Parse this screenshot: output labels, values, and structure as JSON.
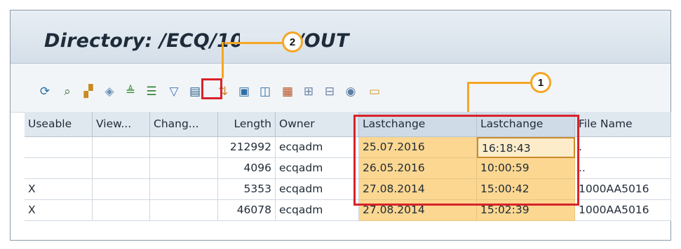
{
  "window": {
    "title": "Directory: /ECQ/10  /WM/OUT"
  },
  "toolbar": {
    "icons": [
      "refresh-icon",
      "search-detail-icon",
      "copy-icon",
      "eraser-icon",
      "sort-ascending-icon",
      "filter-rows-icon",
      "set-filter-icon",
      "export-excel-icon",
      "sort-icon",
      "display-icon",
      "layout-icon",
      "grid-icon",
      "column-icon",
      "column-split-icon",
      "database-icon",
      "folder-icon"
    ]
  },
  "callouts": {
    "one": "1",
    "two": "2"
  },
  "table": {
    "headers": [
      "Useable",
      "View...",
      "Chang...",
      "Length",
      "Owner",
      "Lastchange",
      "Lastchange",
      "File Name"
    ],
    "rows": [
      {
        "useable": "",
        "view": "",
        "chang": "",
        "length": "212992",
        "owner": "ecqadm",
        "date": "25.07.2016",
        "time": "16:18:43",
        "file": "."
      },
      {
        "useable": "",
        "view": "",
        "chang": "",
        "length": "4096",
        "owner": "ecqadm",
        "date": "26.05.2016",
        "time": "10:00:59",
        "file": ".."
      },
      {
        "useable": "X",
        "view": "",
        "chang": "",
        "length": "5353",
        "owner": "ecqadm",
        "date": "27.08.2014",
        "time": "15:00:42",
        "file": "1000AA5016"
      },
      {
        "useable": "X",
        "view": "",
        "chang": "",
        "length": "46078",
        "owner": "ecqadm",
        "date": "27.08.2014",
        "time": "15:02:39",
        "file": "1000AA5016"
      }
    ]
  },
  "colors": {
    "highlight": "#fbd791",
    "annotation_red": "#d9222a",
    "callout_orange": "#f5a623"
  }
}
